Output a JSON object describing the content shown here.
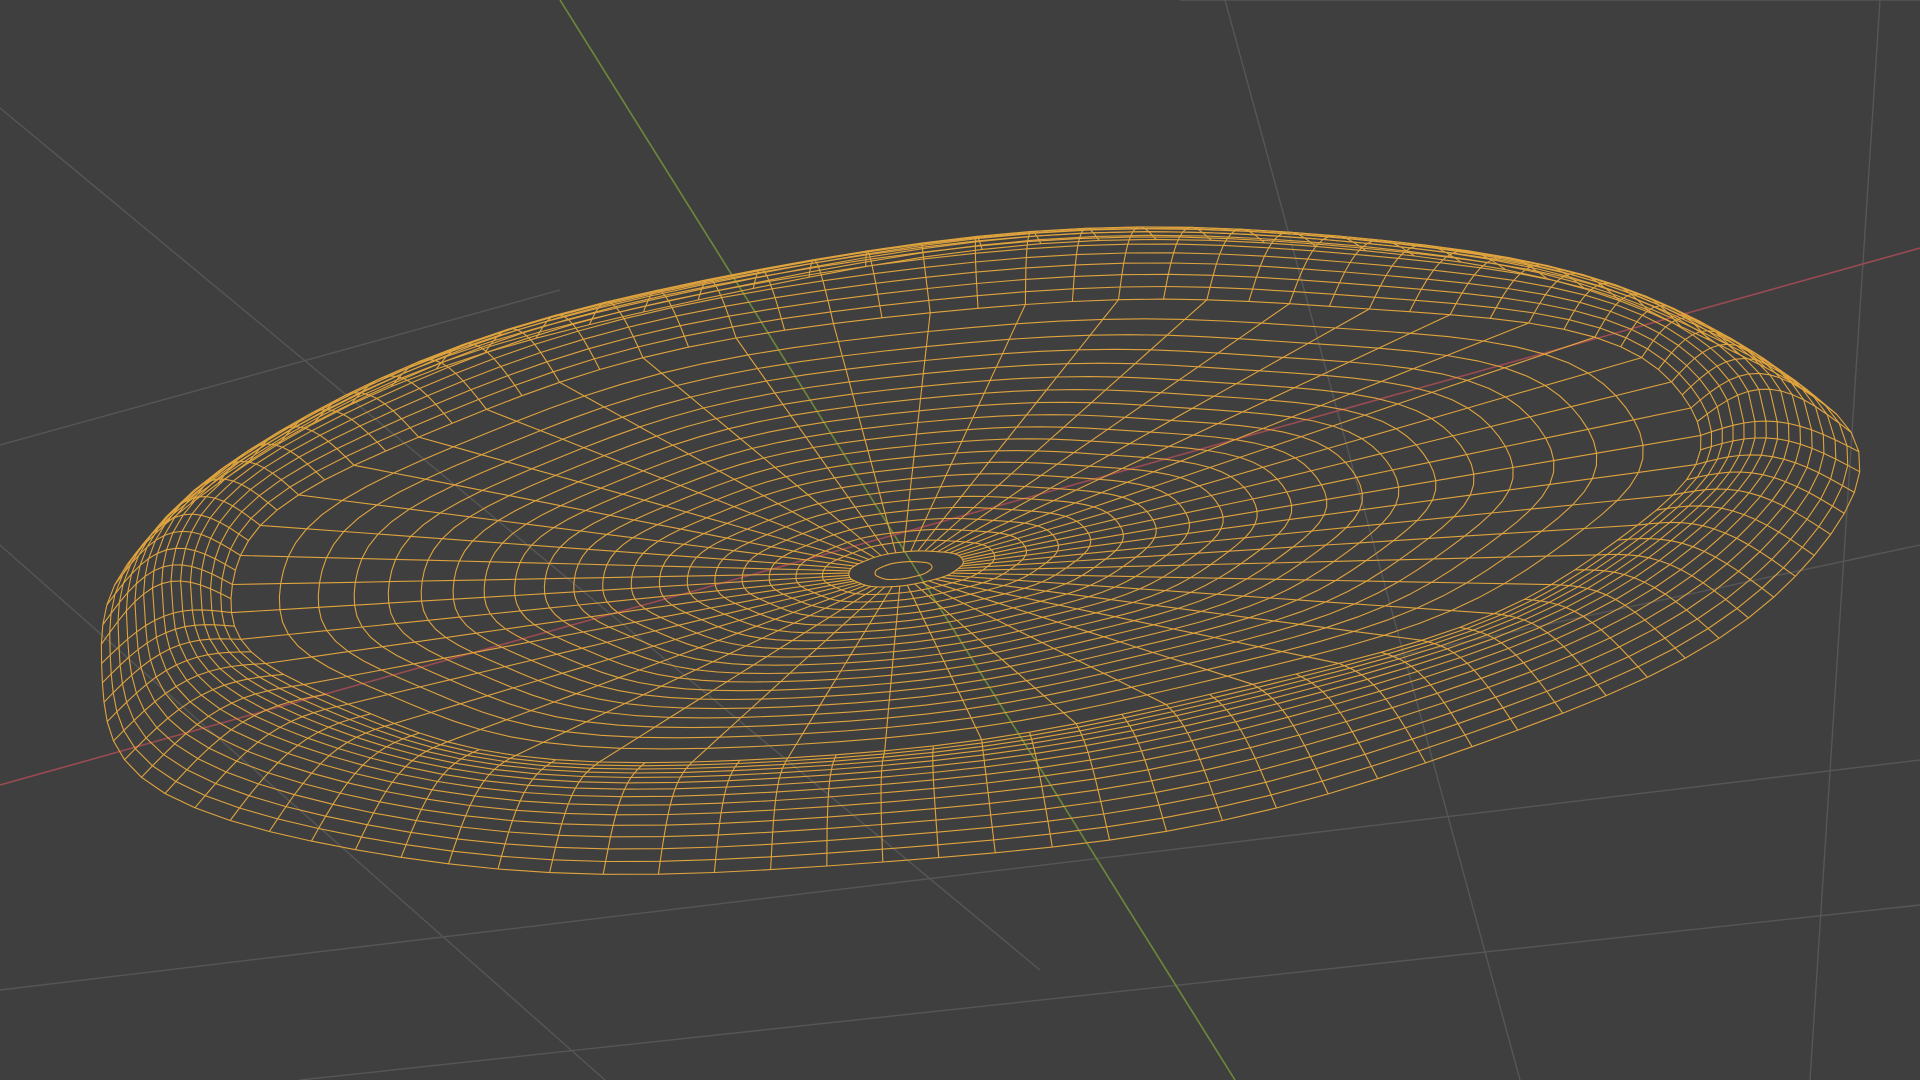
{
  "viewport": {
    "mode": "wireframe",
    "view": "perspective",
    "show_floor_grid": true,
    "show_axes": [
      "x",
      "y"
    ]
  },
  "colors": {
    "background": "#3f3f3f",
    "grid": "#565656",
    "axis_x": "#9a4a52",
    "axis_y": "#6b8a38",
    "wireframe_selected": "#e0a43e"
  },
  "object": {
    "icon": "mesh-object-icon",
    "shape": "shallow-dish",
    "display": "wireframe",
    "selected": true
  }
}
